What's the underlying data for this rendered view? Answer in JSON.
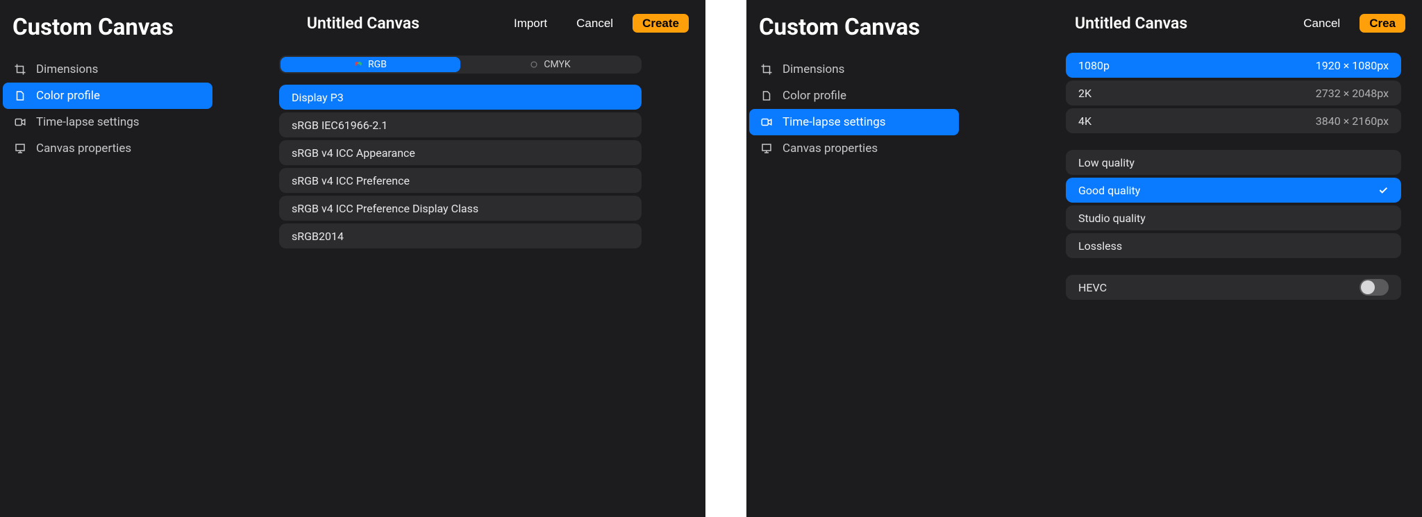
{
  "left": {
    "app_title": "Custom Canvas",
    "doc_title": "Untitled Canvas",
    "buttons": {
      "import": "Import",
      "cancel": "Cancel",
      "create": "Create"
    },
    "sidebar": [
      {
        "label": "Dimensions"
      },
      {
        "label": "Color profile"
      },
      {
        "label": "Time-lapse settings"
      },
      {
        "label": "Canvas properties"
      }
    ],
    "sidebar_active": 1,
    "seg": {
      "a": "RGB",
      "b": "CMYK",
      "active": 0
    },
    "profiles": [
      "Display P3",
      "sRGB IEC61966-2.1",
      "sRGB v4 ICC Appearance",
      "sRGB v4 ICC Preference",
      "sRGB v4 ICC Preference Display Class",
      "sRGB2014"
    ],
    "profiles_selected": 0
  },
  "right": {
    "app_title": "Custom Canvas",
    "doc_title": "Untitled Canvas",
    "buttons": {
      "cancel": "Cancel",
      "create": "Crea"
    },
    "sidebar": [
      {
        "label": "Dimensions"
      },
      {
        "label": "Color profile"
      },
      {
        "label": "Time-lapse settings"
      },
      {
        "label": "Canvas properties"
      }
    ],
    "sidebar_active": 2,
    "resolutions": [
      {
        "name": "1080p",
        "size": "1920 × 1080px"
      },
      {
        "name": "2K",
        "size": "2732 × 2048px"
      },
      {
        "name": "4K",
        "size": "3840 × 2160px"
      }
    ],
    "resolutions_selected": 0,
    "qualities": [
      "Low quality",
      "Good quality",
      "Studio quality",
      "Lossless"
    ],
    "qualities_selected": 1,
    "toggle": {
      "label": "HEVC",
      "on": false
    }
  }
}
